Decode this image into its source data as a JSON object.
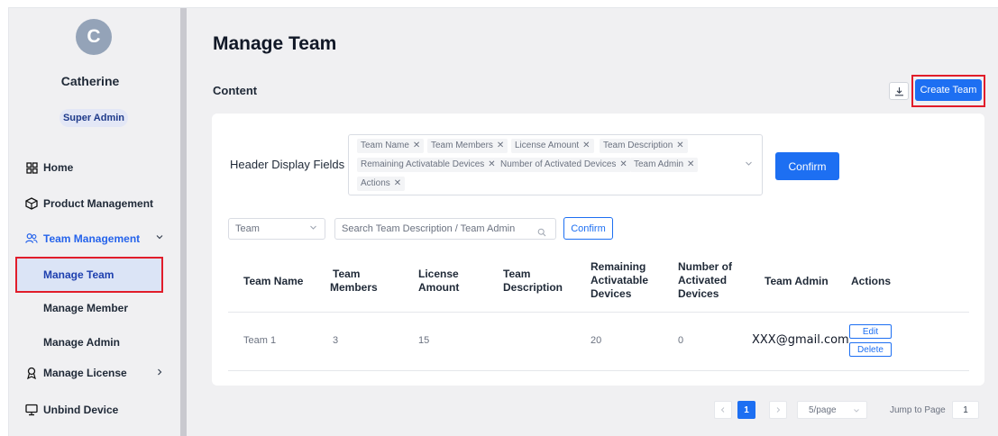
{
  "user": {
    "initial": "C",
    "name": "Catherine",
    "role": "Super Admin"
  },
  "nav": {
    "home": "Home",
    "product_management": "Product Management",
    "team_management": "Team Management",
    "sub": {
      "manage_team": "Manage Team",
      "manage_member": "Manage Member",
      "manage_admin": "Manage Admin"
    },
    "manage_license": "Manage License",
    "unbind_device": "Unbind Device"
  },
  "page": {
    "title": "Manage Team",
    "content_label": "Content",
    "create_button": "Create Team"
  },
  "header_fields": {
    "label": "Header Display Fields",
    "tags": [
      "Team Name",
      "Team Members",
      "License Amount",
      "Team Description",
      "Remaining Activatable Devices",
      "Number of Activated Devices",
      "Team Admin",
      "Actions"
    ],
    "confirm": "Confirm"
  },
  "filter": {
    "select_value": "Team",
    "search_placeholder": "Search Team Description / Team Admin",
    "confirm": "Confirm"
  },
  "table": {
    "headers": {
      "team_name": "Team Name",
      "team_members_1": "Team",
      "team_members_2": "Members",
      "license_amount_1": "License",
      "license_amount_2": "Amount",
      "team_description_1": "Team",
      "team_description_2": "Description",
      "remaining_1": "Remaining",
      "remaining_2": "Activatable",
      "remaining_3": "Devices",
      "activated_1": "Number of",
      "activated_2": "Activated",
      "activated_3": "Devices",
      "team_admin": "Team Admin",
      "actions": "Actions"
    },
    "rows": [
      {
        "team_name": "Team 1",
        "team_members": "3",
        "license_amount": "15",
        "team_description": "",
        "remaining": "20",
        "activated": "0",
        "team_admin": "XXX@gmail.com",
        "edit": "Edit",
        "delete": "Delete"
      }
    ]
  },
  "pagination": {
    "current": "1",
    "page_size": "5/page",
    "jump_label": "Jump to Page",
    "jump_value": "1"
  },
  "colors": {
    "primary": "#1d6ff2",
    "highlight_border": "#e11d2a",
    "sidebar_bg": "#f0f0f2"
  }
}
